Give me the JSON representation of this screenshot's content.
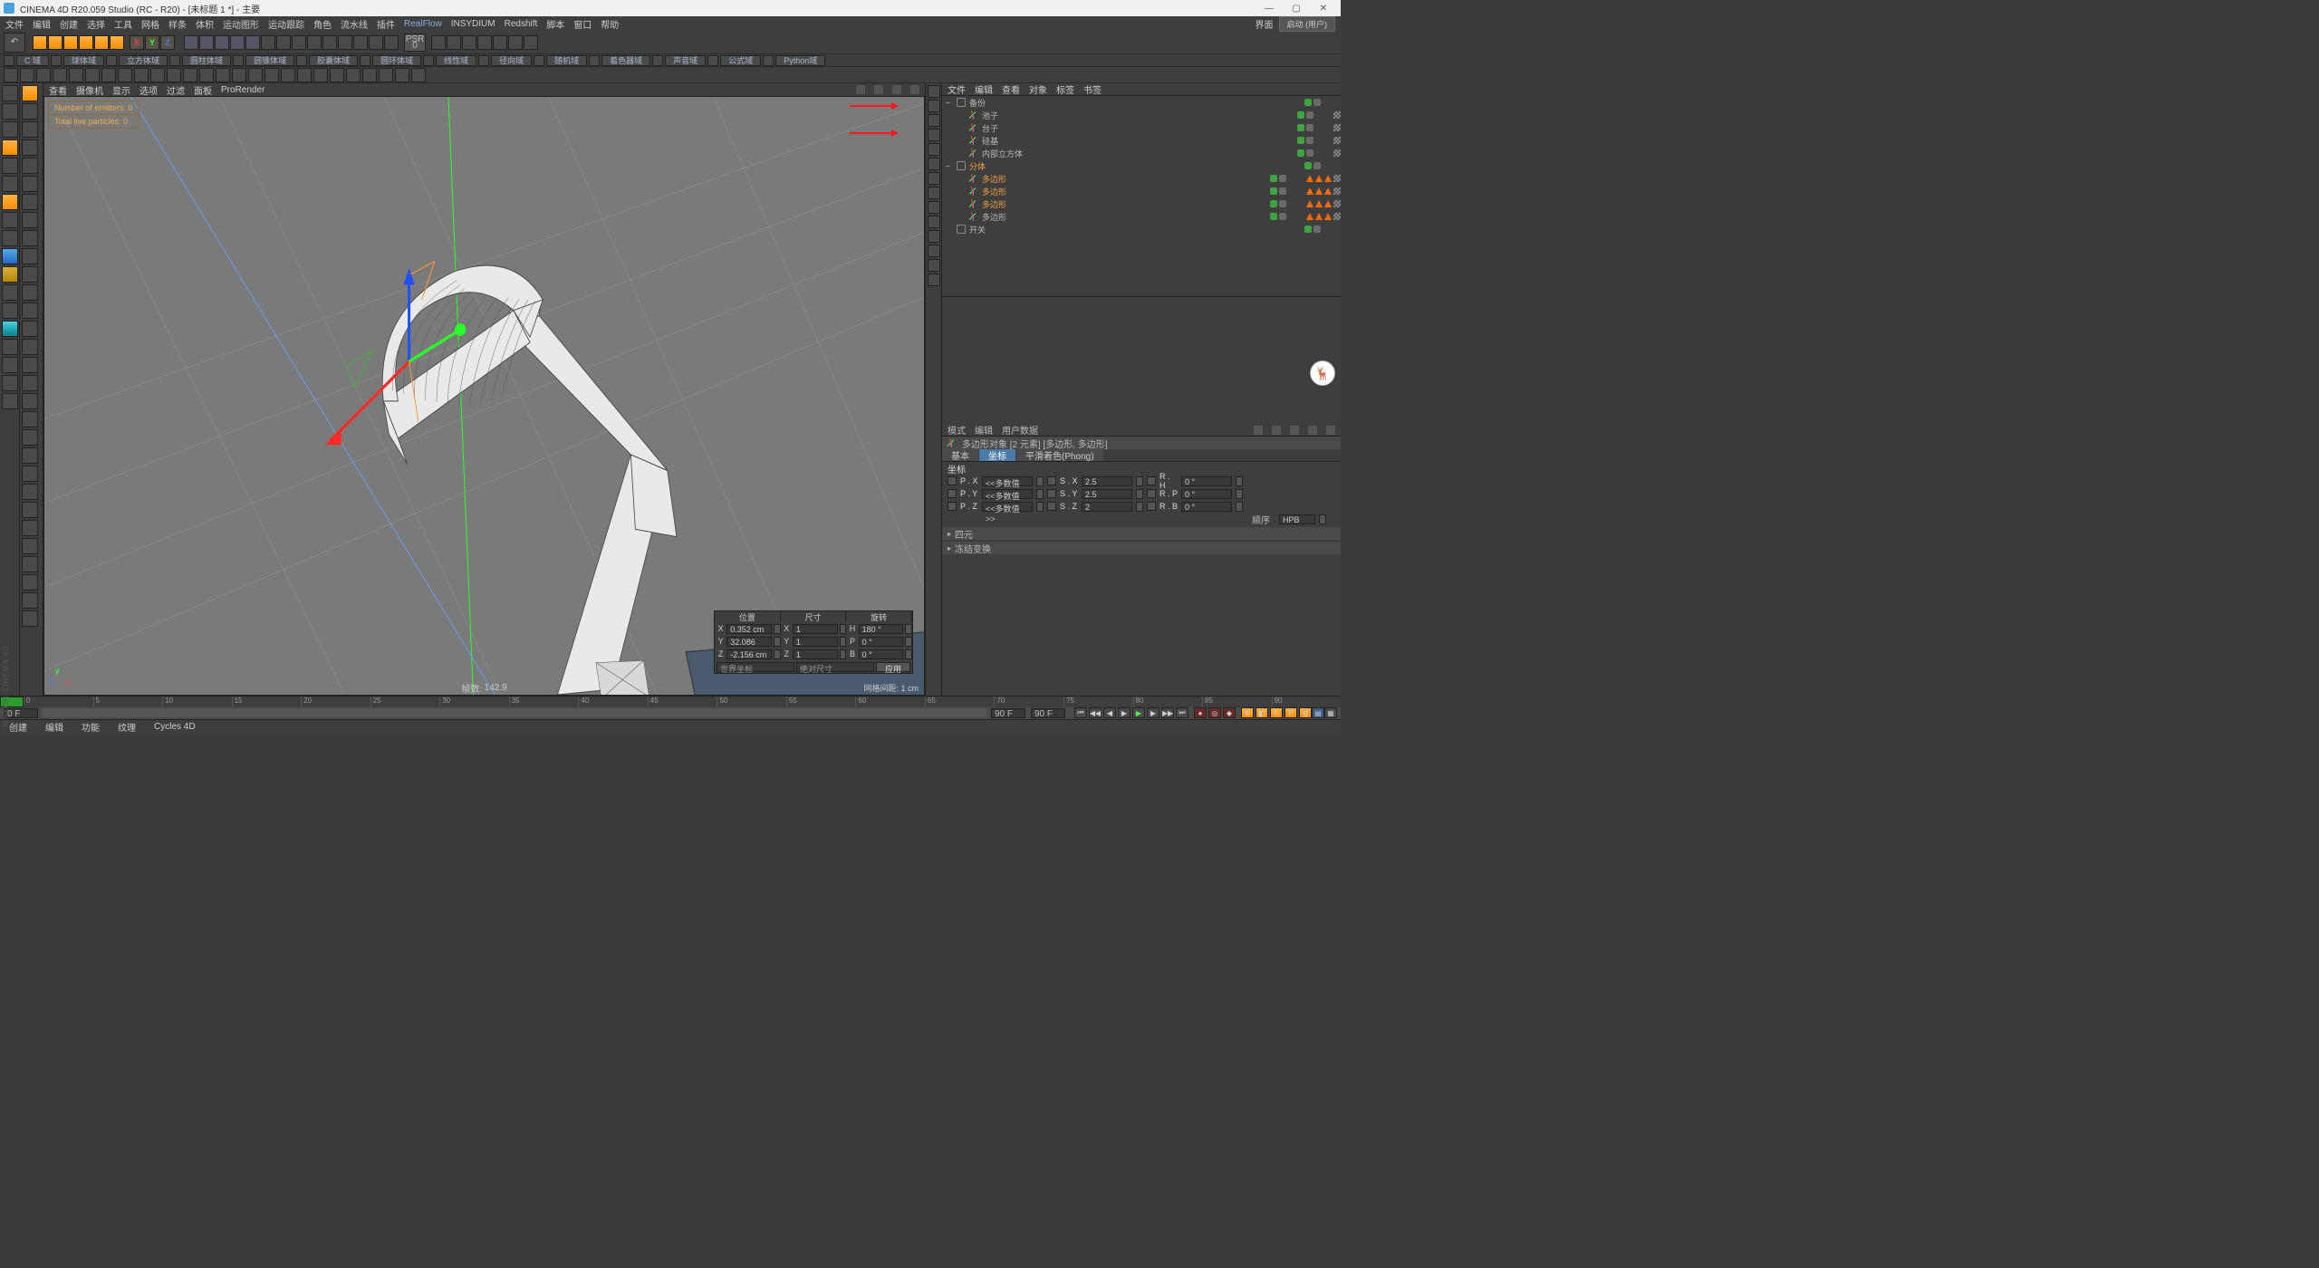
{
  "window": {
    "title": "CINEMA 4D R20.059 Studio (RC - R20) - [未标题 1 *] - 主要",
    "min": "—",
    "max": "▢",
    "close": "✕"
  },
  "menubar": [
    "文件",
    "编辑",
    "创建",
    "选择",
    "工具",
    "网格",
    "样条",
    "体积",
    "运动图形",
    "运动跟踪",
    "角色",
    "流水线",
    "插件",
    "RealFlow",
    "INSYDIUM",
    "Redshift",
    "脚本",
    "窗口",
    "帮助"
  ],
  "layout": {
    "label": "界面",
    "value": "启动 (用户)"
  },
  "axis_btns": [
    "X",
    "Y",
    "Z"
  ],
  "psr": {
    "label": "PSR",
    "value": "0"
  },
  "toolbar2": [
    {
      "icon": true
    },
    {
      "txt": "C 域"
    },
    {
      "icon": true
    },
    {
      "txt": "球体域"
    },
    {
      "icon": true
    },
    {
      "txt": "立方体域"
    },
    {
      "icon": true
    },
    {
      "txt": "圆柱体域"
    },
    {
      "icon": true
    },
    {
      "txt": "圆锥体域"
    },
    {
      "icon": true
    },
    {
      "txt": "胶囊体域"
    },
    {
      "icon": true
    },
    {
      "txt": "圆环体域"
    },
    {
      "icon": true
    },
    {
      "txt": "线性域"
    },
    {
      "icon": true
    },
    {
      "txt": "径向域"
    },
    {
      "icon": true
    },
    {
      "txt": "随机域"
    },
    {
      "icon": true
    },
    {
      "txt": "着色器域"
    },
    {
      "icon": true
    },
    {
      "txt": "声音域"
    },
    {
      "icon": true
    },
    {
      "txt": "公式域"
    },
    {
      "icon": true
    },
    {
      "txt": "Python域"
    }
  ],
  "viewport_menu": [
    "查看",
    "摄像机",
    "显示",
    "选项",
    "过滤",
    "面板",
    "ProRender"
  ],
  "viewport_info": {
    "l1": "Number of emitters: 0",
    "l2": "Total live particles: 0"
  },
  "viewport_status": {
    "frame_label": "帧数:",
    "frame": "142.9",
    "grid_label": "网格间距: 1 cm"
  },
  "axis_indicator": {
    "x": "x",
    "y": "y",
    "z": "z"
  },
  "obj_panel": {
    "tabs": [
      "文件",
      "编辑",
      "查看",
      "对象",
      "标签",
      "书签"
    ]
  },
  "tree": [
    {
      "depth": 0,
      "caret": "−",
      "icon": "null",
      "label": "备份",
      "dots": [
        "grn",
        "gry"
      ],
      "tags": []
    },
    {
      "depth": 1,
      "caret": "",
      "icon": "axis",
      "label": "池子",
      "dots": [
        "grn",
        "gry"
      ],
      "tags": [
        "chk"
      ]
    },
    {
      "depth": 1,
      "caret": "",
      "icon": "axis",
      "label": "台子",
      "dots": [
        "grn",
        "gry"
      ],
      "tags": [
        "chk"
      ]
    },
    {
      "depth": 1,
      "caret": "",
      "icon": "axis",
      "label": "硅基",
      "dots": [
        "grn",
        "gry"
      ],
      "tags": [
        "chk"
      ]
    },
    {
      "depth": 1,
      "caret": "",
      "icon": "axis",
      "label": "内部立方体",
      "dots": [
        "grn",
        "gry"
      ],
      "tags": [
        "chk"
      ]
    },
    {
      "depth": 0,
      "caret": "−",
      "icon": "null",
      "label": "分体",
      "sel": true,
      "dots": [
        "grn",
        "gry"
      ],
      "tags": []
    },
    {
      "depth": 1,
      "caret": "",
      "icon": "axis",
      "label": "多边形",
      "sel": true,
      "dots": [
        "grn",
        "gry"
      ],
      "tags": [
        "tri",
        "tri",
        "tri",
        "chk"
      ]
    },
    {
      "depth": 1,
      "caret": "",
      "icon": "axis",
      "label": "多边形",
      "sel": true,
      "dots": [
        "grn",
        "gry"
      ],
      "tags": [
        "tri",
        "tri",
        "tri",
        "chk"
      ]
    },
    {
      "depth": 1,
      "caret": "",
      "icon": "axis",
      "label": "多边形",
      "sel": true,
      "dots": [
        "grn",
        "gry"
      ],
      "tags": [
        "tri",
        "tri",
        "tri",
        "chk"
      ]
    },
    {
      "depth": 1,
      "caret": "",
      "icon": "axis",
      "label": "多边形",
      "dots": [
        "grn",
        "gry"
      ],
      "tags": [
        "tri",
        "tri",
        "tri",
        "chk"
      ]
    },
    {
      "depth": 0,
      "caret": "",
      "icon": "null",
      "label": "开关",
      "dots": [
        "grn",
        "gry"
      ],
      "tags": []
    }
  ],
  "attr": {
    "tabs": [
      "模式",
      "编辑",
      "用户数据"
    ],
    "head": "多边形对象 [2 元素] [多边形, 多边形]",
    "subtabs": [
      {
        "label": "基本",
        "active": false
      },
      {
        "label": "坐标",
        "active": true
      },
      {
        "label": "平滑着色(Phong)",
        "active": false
      }
    ],
    "section": "坐标",
    "rows": [
      {
        "p": "P . X",
        "pv": "<<多数值>>",
        "s": "S . X",
        "sv": "2.5",
        "r": "R . H",
        "rv": "0 °"
      },
      {
        "p": "P . Y",
        "pv": "<<多数值>>",
        "s": "S . Y",
        "sv": "2.5",
        "r": "R . P",
        "rv": "0 °"
      },
      {
        "p": "P . Z",
        "pv": "<<多数值>>",
        "s": "S . Z",
        "sv": "2",
        "r": "R . B",
        "rv": "0 °"
      }
    ],
    "order_label": "顺序",
    "order_value": "HPB",
    "sections": [
      "四元",
      "冻结变换"
    ]
  },
  "timeline": {
    "frames": [
      "0",
      "5",
      "10",
      "15",
      "20",
      "25",
      "30",
      "35",
      "40",
      "45",
      "50",
      "55",
      "60",
      "65",
      "70",
      "75",
      "80",
      "85",
      "90"
    ],
    "start": "0 F",
    "end": "90 F",
    "end2": "90 F"
  },
  "bottom_tabs": [
    "创建",
    "编辑",
    "功能",
    "纹理",
    "Cycles 4D"
  ],
  "coord_panel": {
    "heads": [
      "位置",
      "尺寸",
      "旋转"
    ],
    "rows": [
      {
        "a": "X",
        "pos": "0.352 cm",
        "szl": "X",
        "sz": "1",
        "rotl": "H",
        "rot": "180 °"
      },
      {
        "a": "Y",
        "pos": "32.086 cm",
        "szl": "Y",
        "sz": "1",
        "rotl": "P",
        "rot": "0 °"
      },
      {
        "a": "Z",
        "pos": "-2.156 cm",
        "szl": "Z",
        "sz": "1",
        "rotl": "B",
        "rot": "0 °"
      }
    ],
    "sel1": "世界坐标",
    "sel2": "绝对尺寸",
    "btn": "应用"
  },
  "brand": "MAXON  CINEMA 4D",
  "deer": "🦌"
}
